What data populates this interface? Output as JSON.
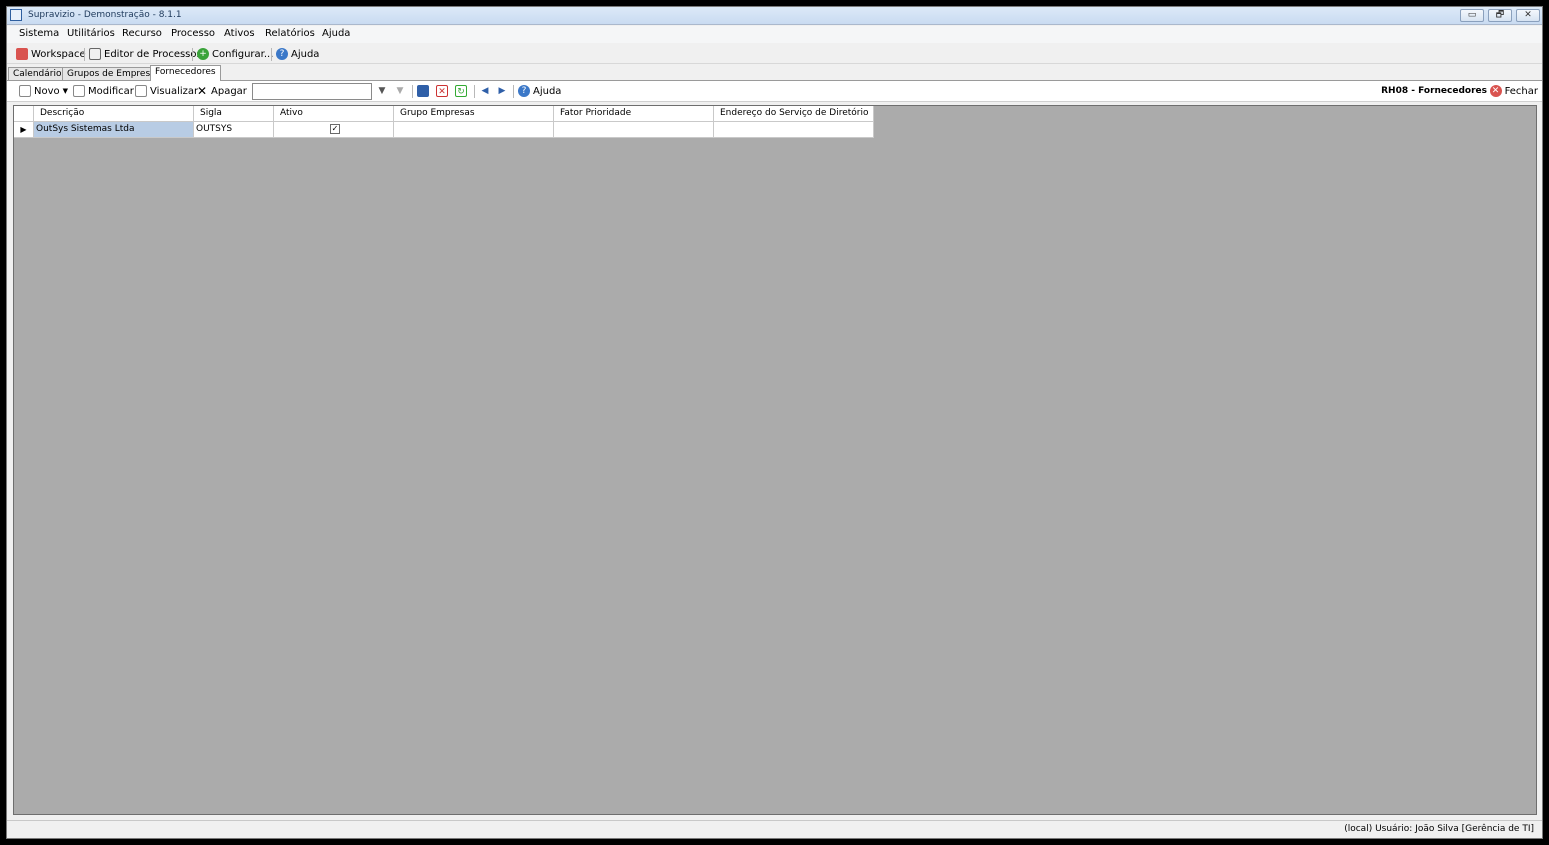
{
  "window": {
    "title": "Supravizio - Demonstração - 8.1.1",
    "minimize": "▭",
    "restore": "🗗",
    "close": "✕"
  },
  "menu": [
    "Sistema",
    "Utilitários",
    "Recurso",
    "Processo",
    "Ativos",
    "Relatórios",
    "Ajuda"
  ],
  "toolbar1": {
    "workspace": "Workspace",
    "process_editor": "Editor de Processos",
    "configure": "Configurar...",
    "help": "Ajuda"
  },
  "tabs": [
    "Calendários",
    "Grupos de Empresas",
    "Fornecedores"
  ],
  "active_tab": "Fornecedores",
  "toolbar2": {
    "new": "Novo",
    "modify": "Modificar",
    "view": "Visualizar",
    "delete": "Apagar",
    "search_value": "",
    "help": "Ajuda",
    "screen_title": "RH08 - Fornecedores",
    "close": "Fechar"
  },
  "grid": {
    "columns": [
      "Descrição",
      "Sigla",
      "Ativo",
      "Grupo Empresas",
      "Fator Prioridade",
      "Endereço do Serviço de Diretório"
    ],
    "rows": [
      {
        "descricao": "OutSys Sistemas Ltda",
        "sigla": "OUTSYS",
        "ativo": "✓",
        "grupo": "",
        "fator": "",
        "endereco": ""
      }
    ]
  },
  "status": {
    "text": "(local)  Usuário: João Silva [Gerência de TI]"
  },
  "icons": {
    "workspace": "briefcase-icon",
    "process_editor": "flowchart-icon",
    "configure": "plus-circle-icon",
    "help": "question-circle-icon",
    "new": "new-document-icon",
    "modify": "edit-icon",
    "view": "view-icon",
    "delete": "x-icon",
    "filter": "filter-icon",
    "save": "save-icon",
    "cancel": "cancel-icon",
    "refresh": "refresh-icon",
    "prev": "arrow-left-icon",
    "next": "arrow-right-icon",
    "close": "close-circle-icon"
  },
  "colors": {
    "grid_background": "#ababab",
    "selection": "#b8cce4",
    "title_bar": "#c9dbf1"
  }
}
